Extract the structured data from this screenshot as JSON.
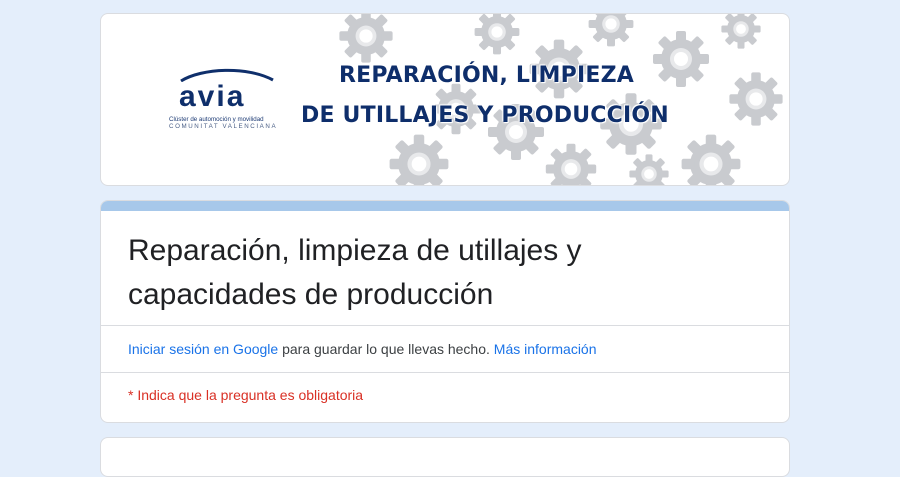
{
  "banner": {
    "logo": {
      "wordmark": "avia",
      "subtitle_line1": "Clúster de automoción y movilidad",
      "subtitle_line2": "COMUNITAT VALENCIANA"
    },
    "headline_line1": "REPARACIÓN, LIMPIEZA",
    "headline_line2": "DE UTILLAJES Y PRODUCCIÓN"
  },
  "form": {
    "title": "Reparación, limpieza de utillajes y capacidades de producción",
    "signin_link": "Iniciar sesión en Google",
    "signin_text": " para guardar lo que llevas hecho. ",
    "more_info_link": "Más información",
    "required_note": "* Indica que la pregunta es obligatoria"
  },
  "colors": {
    "background": "#e4eefb",
    "accent_bar": "#a7c8ea",
    "link": "#1a73e8",
    "required": "#d93025",
    "headline": "#0e2e6b"
  }
}
